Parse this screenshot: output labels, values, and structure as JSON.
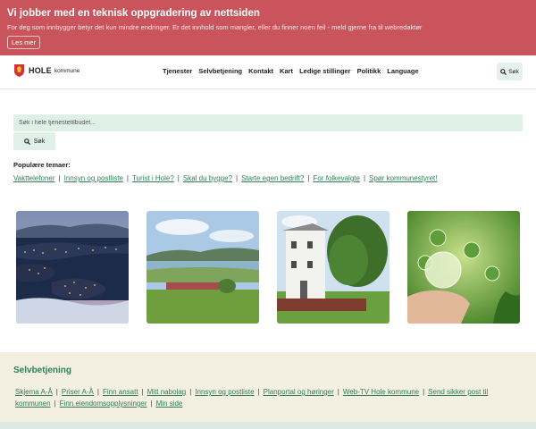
{
  "banner": {
    "title": "Vi jobber med en teknisk oppgradering av nettsiden",
    "text": "For deg som innbygger betyr det kun mindre endringer. Er det innhold som mangler, eller du finner noen feil - meld gjerne fra til webredaktør",
    "button_label": "Les mer"
  },
  "header": {
    "logo_text": "HOLE",
    "logo_sub": "kommune",
    "nav": [
      "Tjenester",
      "Selvbetjening",
      "Kontakt",
      "Kart",
      "Ledige stillinger",
      "Politikk",
      "Language"
    ],
    "search_label": "Søk"
  },
  "search": {
    "placeholder": "Søk i hele tjenestetilbudet...",
    "button_label": "Søk"
  },
  "popular": {
    "title": "Populære temaer:",
    "links": [
      "Vakttelefoner",
      "Innsyn og postliste",
      "Turist i Hole?",
      "Skal du bygge?",
      "Starte egen bedrift?",
      "For folkevalgte",
      "Spør kommunestyret!"
    ]
  },
  "cards": [
    {
      "image": "night-town-lake-photo"
    },
    {
      "image": "lake-fjord-landscape-photo"
    },
    {
      "image": "white-building-tree-photo"
    },
    {
      "image": "co2-hand-plant-photo"
    }
  ],
  "footer": {
    "title": "Selvbetjening",
    "links": [
      "Skjema A-Å",
      "Priser A-Å",
      "Finn ansatt",
      "Mitt nabolag",
      "Innsyn og postliste",
      "Planportal og høringer",
      "Web-TV Hole kommune",
      "Send sikker post til kommunen",
      "Finn eiendomsopplysninger",
      "Min side"
    ]
  },
  "colors": {
    "banner": "#c9545c",
    "accent": "#2f7f55",
    "search_bg": "#dff0e8",
    "footer_bg": "#f3efe1"
  }
}
